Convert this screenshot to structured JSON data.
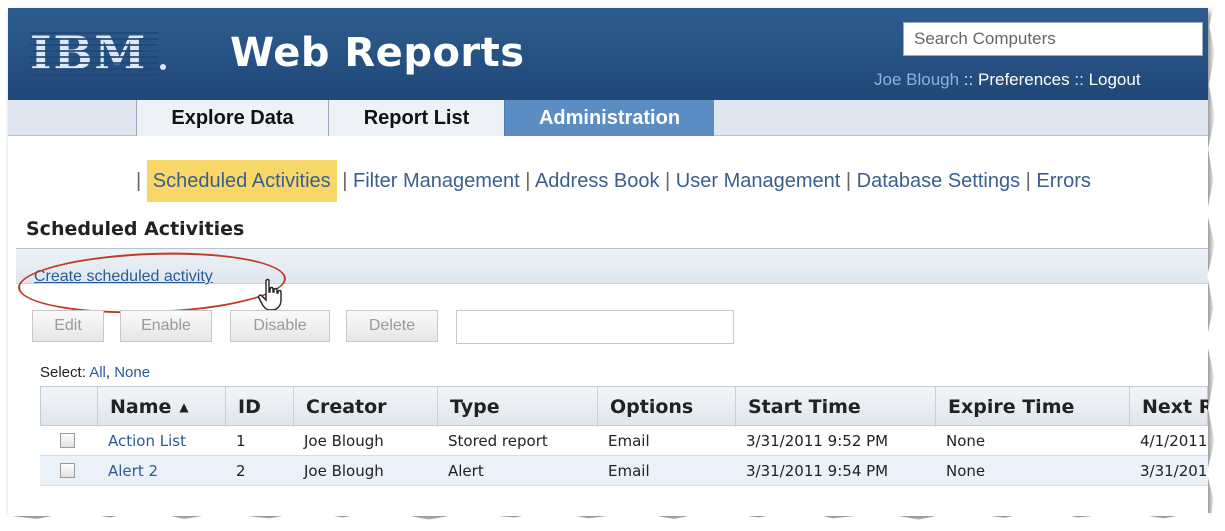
{
  "header": {
    "logo_text": "IBM",
    "app_title": "Web Reports",
    "search_placeholder": "Search Computers",
    "user_name": "Joe Blough",
    "sep1": " :: ",
    "preferences": "Preferences",
    "sep2": " :: ",
    "logout": "Logout"
  },
  "tabs": [
    {
      "label": "Explore Data"
    },
    {
      "label": "Report List"
    },
    {
      "label": "Administration"
    }
  ],
  "subnav": {
    "sep": "|",
    "items": [
      "Scheduled Activities",
      "Filter Management",
      "Address Book",
      "User Management",
      "Database Settings",
      "Errors"
    ]
  },
  "section_title": "Scheduled Activities",
  "create_link": "Create scheduled activity",
  "buttons": {
    "edit": "Edit",
    "enable": "Enable",
    "disable": "Disable",
    "delete": "Delete"
  },
  "select": {
    "label": "Select:",
    "all": "All",
    "comma": ",",
    "none": "None"
  },
  "table": {
    "columns": [
      "Name",
      "ID",
      "Creator",
      "Type",
      "Options",
      "Start Time",
      "Expire Time",
      "Next Run"
    ],
    "rows": [
      {
        "name": "Action List",
        "id": "1",
        "creator": "Joe Blough",
        "type": "Stored report",
        "options": "Email",
        "start": "3/31/2011 9:52 PM",
        "expire": "None",
        "next": "4/1/2011"
      },
      {
        "name": "Alert 2",
        "id": "2",
        "creator": "Joe Blough",
        "type": "Alert",
        "options": "Email",
        "start": "3/31/2011 9:54 PM",
        "expire": "None",
        "next": "3/31/2011"
      }
    ]
  },
  "colors": {
    "header_bg": "#1f4878",
    "active_tab": "#5b8cc2",
    "highlight": "#f7d768",
    "annotation": "#c0392b",
    "link": "#2a5a9a"
  }
}
